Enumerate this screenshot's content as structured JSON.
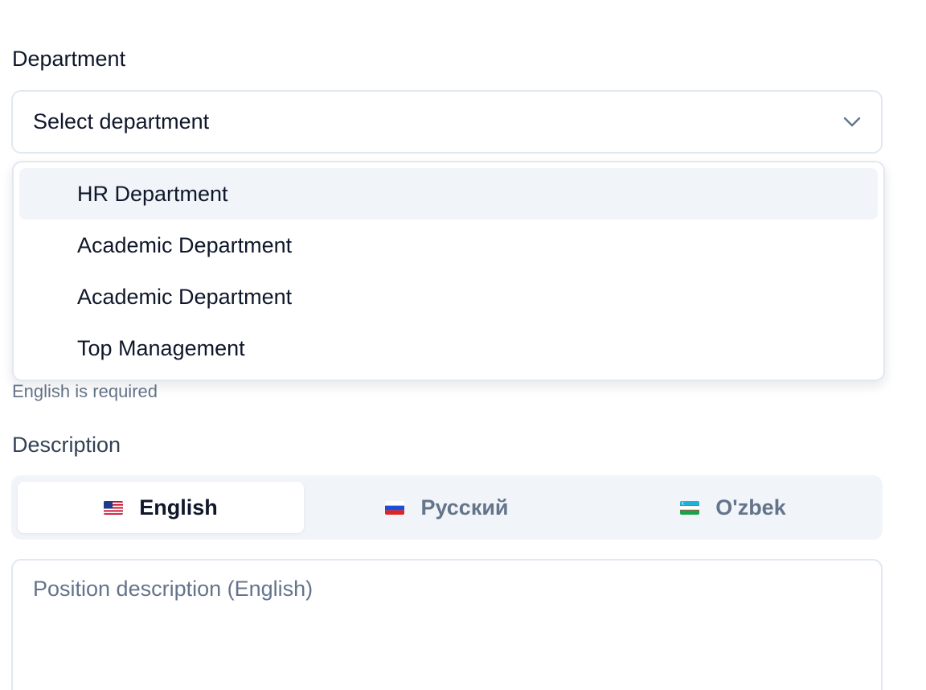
{
  "department": {
    "label": "Department",
    "placeholder": "Select department",
    "icon": "chevron-down-icon",
    "options": [
      {
        "label": "HR Department"
      },
      {
        "label": "Academic Department"
      },
      {
        "label": "Academic Department"
      },
      {
        "label": "Top Management"
      }
    ]
  },
  "validation": {
    "english_required": "English is required"
  },
  "description": {
    "label": "Description",
    "tabs": [
      {
        "label": "English",
        "flag": "us-flag-icon",
        "active": true
      },
      {
        "label": "Русский",
        "flag": "ru-flag-icon",
        "active": false
      },
      {
        "label": "O'zbek",
        "flag": "uz-flag-icon",
        "active": false
      }
    ],
    "placeholder": "Position description (English)"
  },
  "colors": {
    "text": "#0f172a",
    "muted": "#64748b",
    "border": "#e2e8f0",
    "highlight": "#f1f5f9"
  }
}
